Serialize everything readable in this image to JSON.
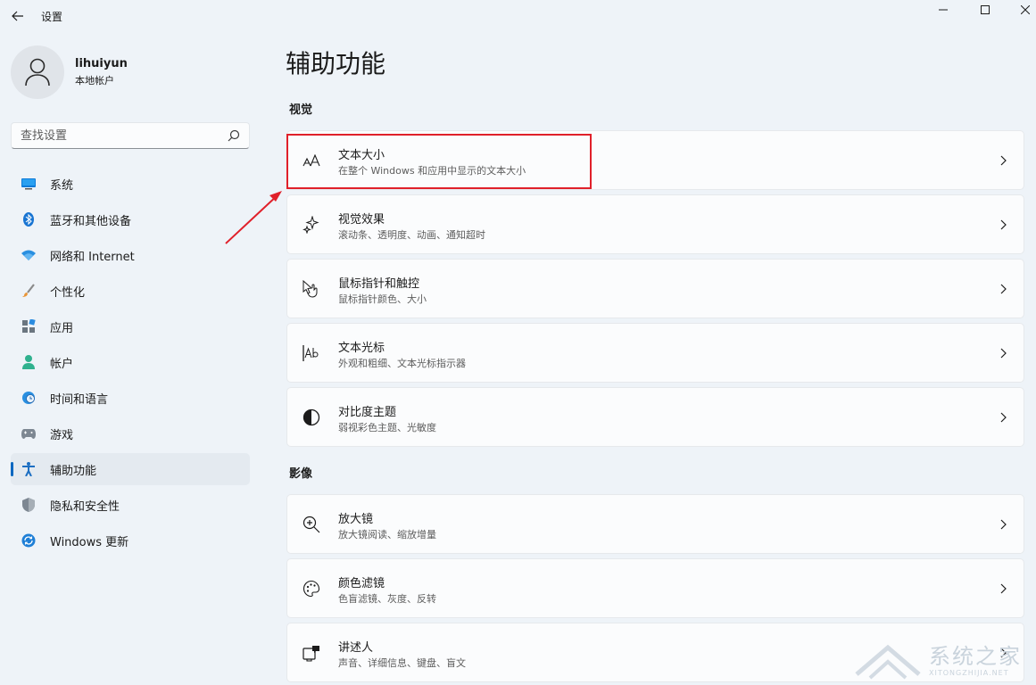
{
  "window": {
    "title": "设置"
  },
  "profile": {
    "name": "lihuiyun",
    "account_type": "本地帐户"
  },
  "search": {
    "placeholder": "查找设置"
  },
  "sidebar": {
    "items": [
      {
        "label": "系统",
        "icon": "monitor-icon"
      },
      {
        "label": "蓝牙和其他设备",
        "icon": "bluetooth-icon"
      },
      {
        "label": "网络和 Internet",
        "icon": "wifi-icon"
      },
      {
        "label": "个性化",
        "icon": "brush-icon"
      },
      {
        "label": "应用",
        "icon": "apps-icon"
      },
      {
        "label": "帐户",
        "icon": "person-icon"
      },
      {
        "label": "时间和语言",
        "icon": "globe-clock-icon"
      },
      {
        "label": "游戏",
        "icon": "gamepad-icon"
      },
      {
        "label": "辅助功能",
        "icon": "accessibility-icon",
        "selected": true
      },
      {
        "label": "隐私和安全性",
        "icon": "shield-icon"
      },
      {
        "label": "Windows 更新",
        "icon": "update-icon"
      }
    ]
  },
  "main": {
    "title": "辅助功能",
    "sections": [
      {
        "title": "视觉",
        "cards": [
          {
            "title": "文本大小",
            "subtitle": "在整个 Windows 和应用中显示的文本大小",
            "icon": "text-size-icon"
          },
          {
            "title": "视觉效果",
            "subtitle": "滚动条、透明度、动画、通知超时",
            "icon": "sparkle-icon"
          },
          {
            "title": "鼠标指针和触控",
            "subtitle": "鼠标指针颜色、大小",
            "icon": "pointer-touch-icon"
          },
          {
            "title": "文本光标",
            "subtitle": "外观和粗细、文本光标指示器",
            "icon": "text-cursor-icon"
          },
          {
            "title": "对比度主题",
            "subtitle": "弱视彩色主题、光敏度",
            "icon": "contrast-icon"
          }
        ]
      },
      {
        "title": "影像",
        "cards": [
          {
            "title": "放大镜",
            "subtitle": "放大镜阅读、缩放增量",
            "icon": "magnifier-icon"
          },
          {
            "title": "颜色滤镜",
            "subtitle": "色盲滤镜、灰度、反转",
            "icon": "palette-icon"
          },
          {
            "title": "讲述人",
            "subtitle": "声音、详细信息、键盘、盲文",
            "icon": "narrator-icon"
          }
        ]
      }
    ]
  },
  "watermark": {
    "text": "系统之家",
    "url_text": "XITONGZHIJIA.NET"
  },
  "colors": {
    "background": "#eef3f8",
    "accent": "#0067c0",
    "highlight_box": "#e0202a",
    "card": "#fbfcfd"
  }
}
